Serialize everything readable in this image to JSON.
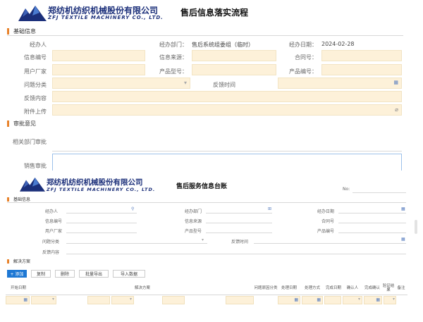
{
  "top_form": {
    "company_cn": "郑纺机纺织机械股份有限公司",
    "company_en": "ZFJ TEXTILE MACHINERY CO., LTD.",
    "title": "售后信息落实流程",
    "basic_section": "基础信息",
    "fields": {
      "handler_label": "经办人",
      "dept_label": "经办部门：",
      "dept_value": "售后系统组委组（临时）",
      "date_label": "经办日期：",
      "date_value": "2024-02-28",
      "info_no_label": "信息编号",
      "info_source_label": "信息来源：",
      "contract_label": "合同号：",
      "customer_label": "用户厂家",
      "product_model_label": "产品型号：",
      "product_no_label": "产品编号：",
      "problem_type_label": "问题分类",
      "feedback_time_label": "反馈时间",
      "feedback_content_label": "反馈内容",
      "attachment_label": "附件上传"
    },
    "review_section": "审批意见",
    "related_dept_label": "相关部门审批",
    "sales_review_label": "销售审批"
  },
  "bottom_form": {
    "company_cn": "郑纺机纺织机械股份有限公司",
    "company_en": "ZFJ TEXTILE MACHINERY CO., LTD.",
    "title": "售后服务信息台账",
    "no_label": "No:",
    "basic_section": "基础信息",
    "fields": {
      "handler_label": "经办人",
      "dept_label": "经办部门",
      "date_label": "经办日期",
      "info_no_label": "信息编号",
      "info_source_label": "信息来源",
      "contract_label": "合同号",
      "customer_label": "用户厂家",
      "product_model_label": "产品型号",
      "product_no_label": "产品编号",
      "problem_type_label": "问题分类",
      "feedback_time_label": "反馈时间",
      "feedback_content_label": "反馈内容"
    },
    "solution_section": "解决方案",
    "toolbar": {
      "add": "+ 添加",
      "copy": "复制",
      "delete": "删除",
      "batch": "批量导出",
      "import": "导入数据"
    },
    "table_headers": [
      "开始日期",
      "解决方案",
      "问题原因分类",
      "处理日期",
      "处理方式",
      "完成日期",
      "确认人",
      "完成确认",
      "验证结果",
      "备注"
    ]
  },
  "colors": {
    "brand": "#1b2f7a",
    "accent": "#e8832c",
    "input_bg": "#fdf1d9",
    "primary_button": "#1e78d4"
  }
}
